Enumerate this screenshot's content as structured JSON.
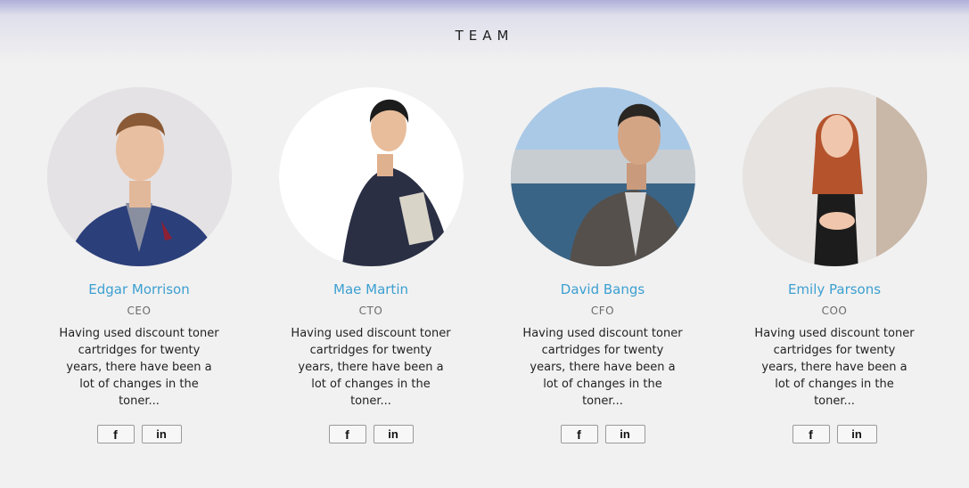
{
  "section": {
    "title": "TEAM"
  },
  "members": [
    {
      "name": "Edgar Morrison",
      "role": "CEO",
      "bio": "Having used discount toner cartridges for twenty years, there have been a lot of changes in the toner...",
      "facebook_icon": "f",
      "linkedin_icon": "in"
    },
    {
      "name": "Mae Martin",
      "role": "CTO",
      "bio": "Having used discount toner cartridges for twenty years, there have been a lot of changes in the toner...",
      "facebook_icon": "f",
      "linkedin_icon": "in"
    },
    {
      "name": "David Bangs",
      "role": "CFO",
      "bio": "Having used discount toner cartridges for twenty years, there have been a lot of changes in the toner...",
      "facebook_icon": "f",
      "linkedin_icon": "in"
    },
    {
      "name": "Emily Parsons",
      "role": "COO",
      "bio": "Having used discount toner cartridges for twenty years, there have been a lot of changes in the toner...",
      "facebook_icon": "f",
      "linkedin_icon": "in"
    }
  ],
  "colors": {
    "accent": "#3c9fd1",
    "background": "#f1f1f1"
  }
}
